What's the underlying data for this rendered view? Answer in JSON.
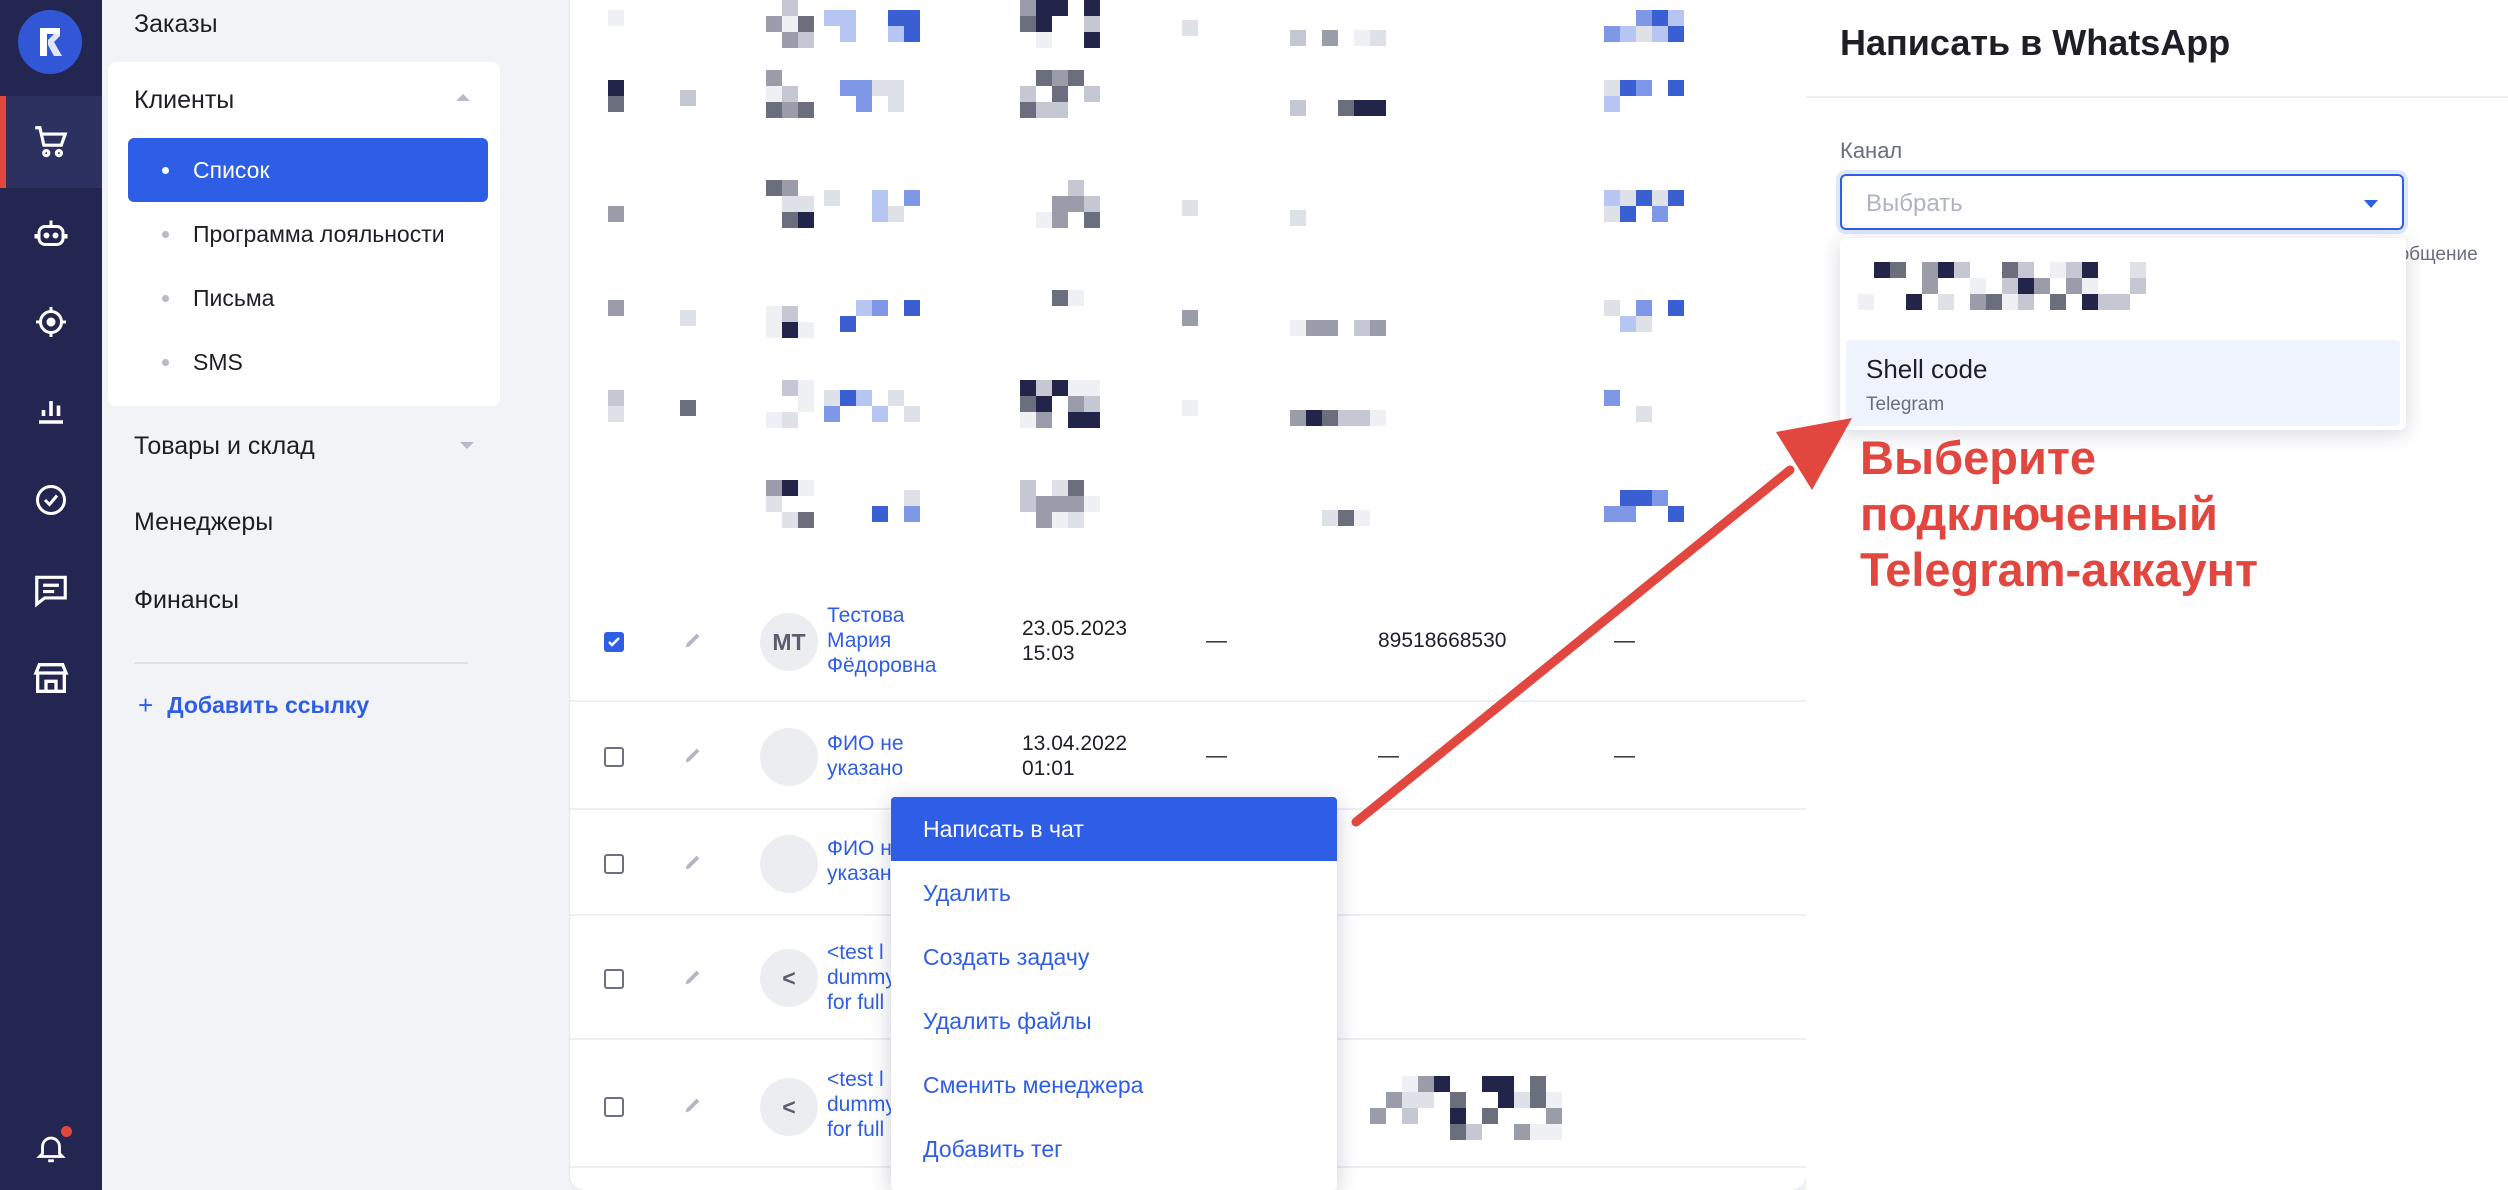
{
  "sidebar": {
    "orders": "Заказы",
    "clients": "Клиенты",
    "clients_sub": [
      "Список",
      "Программа лояльности",
      "Письма",
      "SMS"
    ],
    "goods": "Товары и склад",
    "managers": "Менеджеры",
    "finance": "Финансы",
    "add_link": "Добавить ссылку",
    "add_icon": "+"
  },
  "rail_icons": [
    "logo-icon",
    "cart-icon",
    "bot-icon",
    "target-icon",
    "chart-icon",
    "check-circle-icon",
    "chat-icon",
    "store-icon",
    "bell-icon"
  ],
  "table": {
    "rows": [
      {
        "checked": true,
        "avatar": "МТ",
        "name": "Тестова\nМария\nФёдоровна",
        "date": "23.05.2023\n15:03",
        "col4": "—",
        "phone": "89518668530",
        "col6": "—"
      },
      {
        "checked": false,
        "avatar": "",
        "name": "ФИО не\nуказано",
        "date": "13.04.2022\n01:01",
        "col4": "—",
        "phone": "—",
        "col6": "—"
      },
      {
        "checked": false,
        "avatar": "",
        "name": "ФИО н\nуказан",
        "date": "",
        "col4": "",
        "phone": "",
        "col6": ""
      },
      {
        "checked": false,
        "avatar": "<",
        "name": "<test l\ndummy\nfor full",
        "date": "",
        "col4": "",
        "phone": "",
        "col6": ""
      },
      {
        "checked": false,
        "avatar": "<",
        "name": "<test l\ndummy\nfor full",
        "date": "",
        "col4": "",
        "phone": "",
        "col6": ""
      }
    ]
  },
  "context_menu": {
    "items": [
      "Написать в чат",
      "Удалить",
      "Создать задачу",
      "Удалить файлы",
      "Сменить менеджера",
      "Добавить тег"
    ]
  },
  "panel": {
    "title": "Написать в WhatsApp",
    "channel_label": "Канал",
    "channel_placeholder": "Выбрать",
    "cut_text": "ообщение",
    "options": [
      {
        "title": "Shell code",
        "subtitle": "Telegram"
      }
    ]
  },
  "annotation": "Выберите\nподключенный\nTelegram-аккаунт",
  "colors": {
    "accent": "#2f5ee6",
    "rail": "#232650",
    "annotation": "#e2473f"
  }
}
